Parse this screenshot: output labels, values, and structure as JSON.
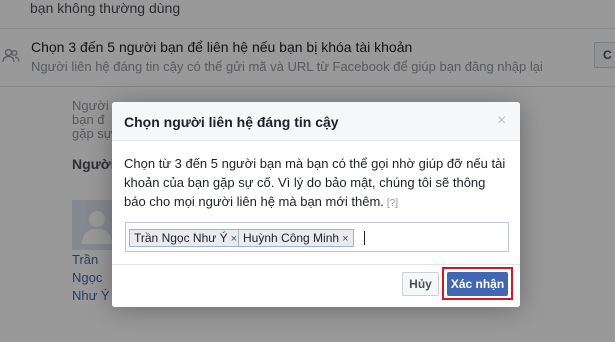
{
  "background": {
    "top_text": "bạn không thường dùng",
    "setting": {
      "title": "Chọn 3 đến 5 người bạn để liên hệ nếu bạn bị khóa tài khoản",
      "description": "Người liên hệ đáng tin cậy có thể gửi mã và URL từ Facebook để giúp bạn đăng nhập lại",
      "edit_label": "C"
    },
    "fragments": [
      "Người",
      "bạn đ",
      "gặp sự"
    ],
    "people_label": "Người",
    "friend_name_lines": [
      "Trần",
      "Ngọc",
      "Như Ý"
    ]
  },
  "dialog": {
    "title": "Chọn người liên hệ đáng tin cậy",
    "close_symbol": "×",
    "body": "Chọn từ 3 đến 5 người bạn mà bạn có thể gọi nhờ giúp đỡ nếu tài khoản của bạn gặp sự cố. Vì lý do bảo mật, chúng tôi sẽ thông báo cho mọi người liên hệ mà bạn mới thêm.",
    "help_link": "[?]",
    "tokens": [
      {
        "label": "Trần Ngọc Như Ý",
        "remove": "×"
      },
      {
        "label": "Huỳnh Công Minh",
        "remove": "×"
      }
    ],
    "cancel_label": "Hủy",
    "confirm_label": "Xác nhận"
  },
  "colors": {
    "primary": "#4267b2",
    "highlight": "#d0182b",
    "overlay": "rgba(0,0,0,0.40)"
  }
}
